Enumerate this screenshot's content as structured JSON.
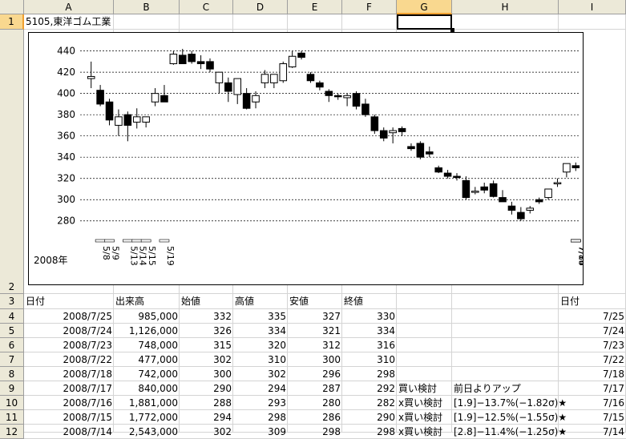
{
  "columns": [
    "A",
    "B",
    "C",
    "D",
    "E",
    "F",
    "G",
    "H",
    "I"
  ],
  "selected_column": "G",
  "rows": [
    "1",
    "2",
    "3",
    "4",
    "5",
    "6",
    "7",
    "8",
    "9",
    "10",
    "11",
    "12"
  ],
  "selected_row": "1",
  "a1": "5105,東洋ゴム工業",
  "headers": {
    "date": "日付",
    "volume": "出来高",
    "open": "始値",
    "high": "高値",
    "low": "安値",
    "close": "終値",
    "date2": "日付"
  },
  "table": [
    {
      "date": "2008/7/25",
      "volume": "985,000",
      "open": "332",
      "high": "335",
      "low": "327",
      "close": "330",
      "g": "",
      "h": "",
      "i": "7/25"
    },
    {
      "date": "2008/7/24",
      "volume": "1,126,000",
      "open": "326",
      "high": "334",
      "low": "321",
      "close": "334",
      "g": "",
      "h": "",
      "i": "7/24"
    },
    {
      "date": "2008/7/23",
      "volume": "748,000",
      "open": "315",
      "high": "320",
      "low": "312",
      "close": "316",
      "g": "",
      "h": "",
      "i": "7/23"
    },
    {
      "date": "2008/7/22",
      "volume": "477,000",
      "open": "302",
      "high": "310",
      "low": "300",
      "close": "310",
      "g": "",
      "h": "",
      "i": "7/22"
    },
    {
      "date": "2008/7/18",
      "volume": "742,000",
      "open": "300",
      "high": "302",
      "low": "296",
      "close": "298",
      "g": "",
      "h": "",
      "i": "7/18"
    },
    {
      "date": "2008/7/17",
      "volume": "840,000",
      "open": "290",
      "high": "294",
      "low": "287",
      "close": "292",
      "g": "買い検討",
      "h": "前日よりアップ",
      "i": "7/17"
    },
    {
      "date": "2008/7/16",
      "volume": "1,881,000",
      "open": "288",
      "high": "293",
      "low": "280",
      "close": "282",
      "g": "x買い検討",
      "h": "[1.9]−13.7%(−1.82σ)★",
      "i": "7/16"
    },
    {
      "date": "2008/7/15",
      "volume": "1,772,000",
      "open": "294",
      "high": "298",
      "low": "286",
      "close": "290",
      "g": "x買い検討",
      "h": "[1.9]−12.5%(−1.55σ)★",
      "i": "7/15"
    },
    {
      "date": "2008/7/14",
      "volume": "2,543,000",
      "open": "302",
      "high": "309",
      "low": "298",
      "close": "298",
      "g": "x買い検討",
      "h": "[2.8]−11.4%(−1.25σ)★",
      "i": "7/14"
    }
  ],
  "chart_data": {
    "type": "candlestick",
    "year_label": "2008年",
    "ylim": [
      270,
      445
    ],
    "yticks": [
      280,
      300,
      320,
      340,
      360,
      380,
      400,
      420,
      440
    ],
    "grid": true,
    "date_labels": [
      "5/8",
      "5/9",
      "5/13",
      "5/14",
      "5/15",
      "5/19",
      "7/8",
      "7/14",
      "7/15",
      "7/16"
    ],
    "date_label_index": [
      1,
      2,
      4,
      5,
      6,
      8,
      53,
      57,
      58,
      59
    ],
    "candles": [
      {
        "o": 414,
        "h": 430,
        "l": 405,
        "c": 416
      },
      {
        "o": 403,
        "h": 408,
        "l": 388,
        "c": 390
      },
      {
        "o": 392,
        "h": 395,
        "l": 370,
        "c": 375
      },
      {
        "o": 370,
        "h": 385,
        "l": 360,
        "c": 378
      },
      {
        "o": 380,
        "h": 383,
        "l": 355,
        "c": 370
      },
      {
        "o": 373,
        "h": 386,
        "l": 367,
        "c": 378
      },
      {
        "o": 373,
        "h": 378,
        "l": 368,
        "c": 378
      },
      {
        "o": 392,
        "h": 405,
        "l": 388,
        "c": 400
      },
      {
        "o": 398,
        "h": 408,
        "l": 392,
        "c": 392
      },
      {
        "o": 428,
        "h": 440,
        "l": 427,
        "c": 437
      },
      {
        "o": 436,
        "h": 442,
        "l": 428,
        "c": 428
      },
      {
        "o": 437,
        "h": 440,
        "l": 428,
        "c": 430
      },
      {
        "o": 430,
        "h": 436,
        "l": 423,
        "c": 428
      },
      {
        "o": 430,
        "h": 433,
        "l": 420,
        "c": 423
      },
      {
        "o": 410,
        "h": 420,
        "l": 400,
        "c": 420
      },
      {
        "o": 410,
        "h": 415,
        "l": 392,
        "c": 402
      },
      {
        "o": 399,
        "h": 412,
        "l": 390,
        "c": 414
      },
      {
        "o": 400,
        "h": 405,
        "l": 385,
        "c": 386
      },
      {
        "o": 392,
        "h": 402,
        "l": 386,
        "c": 398
      },
      {
        "o": 410,
        "h": 422,
        "l": 405,
        "c": 418
      },
      {
        "o": 410,
        "h": 418,
        "l": 405,
        "c": 418
      },
      {
        "o": 412,
        "h": 430,
        "l": 410,
        "c": 428
      },
      {
        "o": 425,
        "h": 440,
        "l": 424,
        "c": 435
      },
      {
        "o": 438,
        "h": 440,
        "l": 432,
        "c": 434
      },
      {
        "o": 418,
        "h": 420,
        "l": 410,
        "c": 412
      },
      {
        "o": 410,
        "h": 412,
        "l": 403,
        "c": 406
      },
      {
        "o": 402,
        "h": 404,
        "l": 392,
        "c": 398
      },
      {
        "o": 398,
        "h": 400,
        "l": 394,
        "c": 397
      },
      {
        "o": 396,
        "h": 400,
        "l": 388,
        "c": 398
      },
      {
        "o": 400,
        "h": 402,
        "l": 385,
        "c": 388
      },
      {
        "o": 390,
        "h": 395,
        "l": 378,
        "c": 380
      },
      {
        "o": 378,
        "h": 380,
        "l": 362,
        "c": 365
      },
      {
        "o": 365,
        "h": 368,
        "l": 355,
        "c": 358
      },
      {
        "o": 363,
        "h": 368,
        "l": 353,
        "c": 365
      },
      {
        "o": 367,
        "h": 369,
        "l": 360,
        "c": 364
      },
      {
        "o": 350,
        "h": 353,
        "l": 346,
        "c": 348
      },
      {
        "o": 353,
        "h": 355,
        "l": 338,
        "c": 340
      },
      {
        "o": 345,
        "h": 350,
        "l": 340,
        "c": 343
      },
      {
        "o": 330,
        "h": 332,
        "l": 325,
        "c": 326
      },
      {
        "o": 325,
        "h": 328,
        "l": 320,
        "c": 322
      },
      {
        "o": 322,
        "h": 325,
        "l": 318,
        "c": 321
      },
      {
        "o": 318,
        "h": 322,
        "l": 300,
        "c": 302
      },
      {
        "o": 308,
        "h": 312,
        "l": 305,
        "c": 308
      },
      {
        "o": 312,
        "h": 316,
        "l": 306,
        "c": 309
      },
      {
        "o": 315,
        "h": 318,
        "l": 302,
        "c": 303
      },
      {
        "o": 302,
        "h": 309,
        "l": 298,
        "c": 298
      },
      {
        "o": 294,
        "h": 298,
        "l": 286,
        "c": 290
      },
      {
        "o": 288,
        "h": 293,
        "l": 280,
        "c": 282
      },
      {
        "o": 290,
        "h": 294,
        "l": 287,
        "c": 292
      },
      {
        "o": 300,
        "h": 302,
        "l": 296,
        "c": 298
      },
      {
        "o": 302,
        "h": 310,
        "l": 300,
        "c": 310
      },
      {
        "o": 315,
        "h": 320,
        "l": 312,
        "c": 316
      },
      {
        "o": 326,
        "h": 334,
        "l": 321,
        "c": 334
      },
      {
        "o": 332,
        "h": 335,
        "l": 327,
        "c": 330
      }
    ]
  }
}
